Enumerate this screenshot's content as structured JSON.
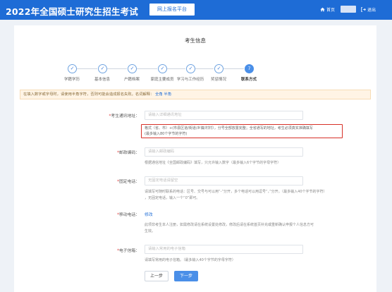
{
  "header": {
    "title": "2022年全国硕士研究生招生考试",
    "platform_label": "网上报名平台",
    "home_label": "首页",
    "logout_label": "退出"
  },
  "card": {
    "title": "考生信息"
  },
  "steps": [
    {
      "label": "学籍学历",
      "state": "done",
      "mark": "✓"
    },
    {
      "label": "基本信息",
      "state": "done",
      "mark": "✓"
    },
    {
      "label": "户籍档案",
      "state": "done",
      "mark": "✓"
    },
    {
      "label": "家庭主要成员",
      "state": "done",
      "mark": "✓"
    },
    {
      "label": "学习与工作经历",
      "state": "done",
      "mark": "✓"
    },
    {
      "label": "奖惩情况",
      "state": "done",
      "mark": "✓"
    },
    {
      "label": "联系方式",
      "state": "active",
      "mark": "7"
    }
  ],
  "notice": {
    "text": "在填入数字或字母时，请使用半角字符，否则可能会造成报名失败。名词解释：",
    "link1": "全角",
    "link2": "半角"
  },
  "form": {
    "address": {
      "label": "考生通讯地址：",
      "placeholder": "请输入详细通讯地址",
      "hint_line1": "格式（省、市）+(市县区道/街道/乡镇/村村），分号全部放置完整；全省通写的地址，考生必须真实准确填写",
      "hint_line2": "(最多输入80个字节的字符)"
    },
    "postcode": {
      "label": "邮政编码：",
      "placeholder": "请输入邮政编码",
      "hint": "根据通信地址《全国邮政编码》填写，只允许输入数字（最多输入6个字节的字母字符）"
    },
    "phone": {
      "label": "固定电话：",
      "placeholder": "无固定电话请留空",
      "hint_line1": "请填写可随时联系的电话：区号、交号与可以用“-”分开，多个电话可以用逗号“，”分开。（最多输入40个字节的字符）",
      "hint_line2": "，无固定电话，输入一个“0”即可。"
    },
    "mobile": {
      "label": "移动电话：",
      "link": "修改",
      "hint_line1": "此项非考生本人注册，如需修改请在系统设置处修改，修改后请在系统首页补充或重新确认申报个人信息方可",
      "hint_line2": "生效。"
    },
    "email": {
      "label": "电子信箱：",
      "placeholder": "请输入常用的电子信箱",
      "hint": "请填写常用的电子信箱。（最多输入40个字节的字母字符）"
    },
    "required_mark": "*"
  },
  "buttons": {
    "prev": "上一步",
    "next": "下一步"
  },
  "colors": {
    "topbar": "#1e6cd6",
    "accent": "#4a8fe8",
    "highlight": "#d73027"
  }
}
